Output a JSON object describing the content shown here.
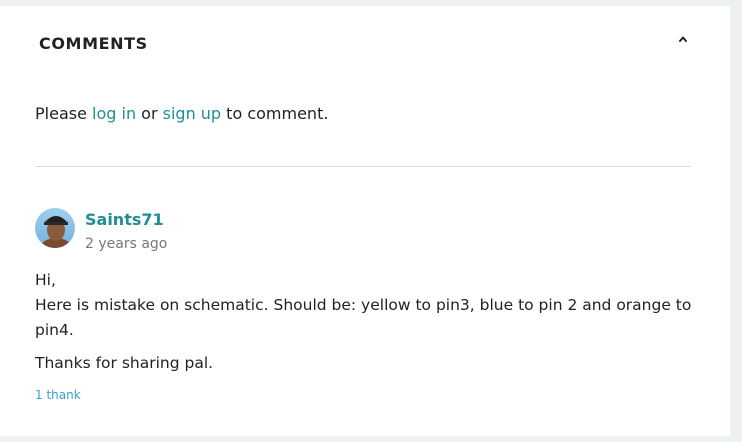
{
  "comments": {
    "title": "COMMENTS",
    "collapse_icon": "chevron-up-icon",
    "prompt": {
      "prefix": "Please ",
      "login_label": "log in",
      "middle": " or ",
      "signup_label": "sign up",
      "suffix": " to comment."
    },
    "items": [
      {
        "author": "Saints71",
        "time": "2 years ago",
        "lines": [
          "Hi,",
          "Here is mistake on schematic. Should be: yellow to pin3, blue to pin 2 and orange to pin4."
        ],
        "closing": "Thanks for sharing pal.",
        "thanks": "1 thank"
      }
    ]
  },
  "colors": {
    "accent": "#1f8e95",
    "thanks_link": "#3a9dd0",
    "text": "#222222",
    "muted": "#777777",
    "page_bg": "#edf1ef"
  }
}
